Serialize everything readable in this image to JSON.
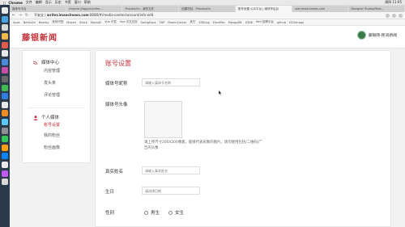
{
  "os_menubar": {
    "app": "Chrome",
    "items": [
      "文件",
      "编辑",
      "显示",
      "历史",
      "书签",
      "窗口",
      "帮助"
    ],
    "right": "周四 11:05"
  },
  "browser": {
    "tabs": [
      "媒体号平台",
      "chrome://bgsync/refre...",
      "ProcessOn - 我的文件",
      "创建项目 - ProcessOn",
      "账号设置-公众平台 | 媒体号后台",
      "user.imaeclnews.com",
      "Designer Studio/Main..."
    ],
    "url_prefix": "不安全 |",
    "url_host": "writer.imaeclnews.com",
    "url_path": ":8080/#/media-center/account/info-edit",
    "bookmarks": [
      "Apps",
      "NetSuite",
      "Nearby",
      "其他书签",
      "Maven",
      "Stack",
      "MockAll",
      "Vue 开发",
      "Vue 中文文档",
      "SwingDocs",
      "FDP",
      "BeannCenter",
      "其它",
      "SSDLog",
      "ElectRec",
      "MongoDB",
      "X3DK",
      "Bell 招聘平台",
      "github",
      "ESGlmage"
    ]
  },
  "site": {
    "logo": "藤银新闻",
    "user_name": "藤银网-民间新闻"
  },
  "sidebar": {
    "groups": [
      {
        "title": "媒体中心",
        "icon": "rss-icon",
        "items": [
          "内容管理",
          "发头条",
          "评论管理"
        ]
      },
      {
        "title": "个人媒体",
        "icon": "person-icon",
        "items": [
          "账号设置",
          "我的粉丝",
          "粉丝画像"
        ]
      }
    ],
    "active_item": "账号设置"
  },
  "main": {
    "title": "账号设置",
    "nickname": {
      "label": "媒体号昵称",
      "placeholder": "请输入媒体号名称"
    },
    "avatar": {
      "label": "媒体号头像",
      "hint": "请上传尺寸200X200像素，能够代表形象的图片。请勿使用包括/二维码/广告的头像"
    },
    "real_name": {
      "label": "真实姓名",
      "placeholder": "请输入真实姓名"
    },
    "birthday": {
      "label": "生日",
      "placeholder": "请选择日期"
    },
    "gender": {
      "label": "性别",
      "options": [
        "男生",
        "女生"
      ]
    }
  },
  "colors": {
    "accent": "#c2313b",
    "dock": "#2b3a4a"
  }
}
